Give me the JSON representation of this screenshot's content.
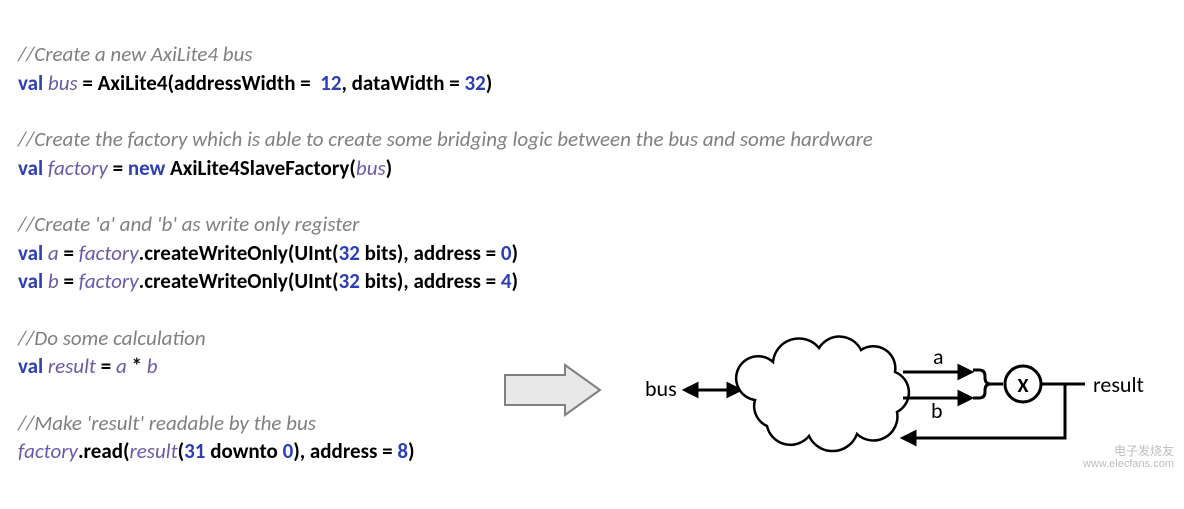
{
  "code": {
    "c1": "//Create a new AxiLite4 bus",
    "l1": {
      "val": "val",
      "bus": "bus",
      "eq": " = ",
      "ty": "AxiLite4",
      "op1": "(addressWidth =  ",
      "n1": "12",
      "comma": ", dataWidth = ",
      "n2": "32",
      "close": ")"
    },
    "c2": "//Create the factory which is able to create some bridging logic between the bus and some hardware",
    "l2": {
      "val": "val",
      "factory": "factory",
      "eq": " = ",
      "new": "new",
      "sp": " ",
      "ty": "AxiLite4SlaveFactory",
      "op": "(",
      "bus": "bus",
      "close": ")"
    },
    "c3": "//Create 'a' and 'b' as write only register",
    "l3": {
      "val": "val",
      "a": "a",
      "eq": " = ",
      "factory": "factory",
      "call": ".createWriteOnly(UInt(",
      "n": "32",
      "bits": " bits",
      "mid": "), address = ",
      "addr": "0",
      "close": ")"
    },
    "l4": {
      "val": "val",
      "b": "b",
      "eq": " = ",
      "factory": "factory",
      "call": ".createWriteOnly(UInt(",
      "n": "32",
      "bits": " bits",
      "mid": "), address = ",
      "addr": "4",
      "close": ")"
    },
    "c4": "//Do some calculation",
    "l5": {
      "val": "val",
      "result": "result",
      "eq": " = ",
      "a": "a",
      "op": " * ",
      "b": "b"
    },
    "c5": "//Make 'result' readable by the bus",
    "l6": {
      "factory": "factory",
      "call": ".read(",
      "result": "result",
      "open": "(",
      "n1": "31",
      "downto": " downto ",
      "n2": "0",
      "mid": "), address = ",
      "addr": "8",
      "close": ")"
    }
  },
  "diagram": {
    "bus_label": "bus",
    "a_label": "a",
    "b_label": "b",
    "op_label": "X",
    "result_label": "result"
  },
  "watermark": {
    "cn": "电子发烧友",
    "url": "www.elecfans.com"
  }
}
